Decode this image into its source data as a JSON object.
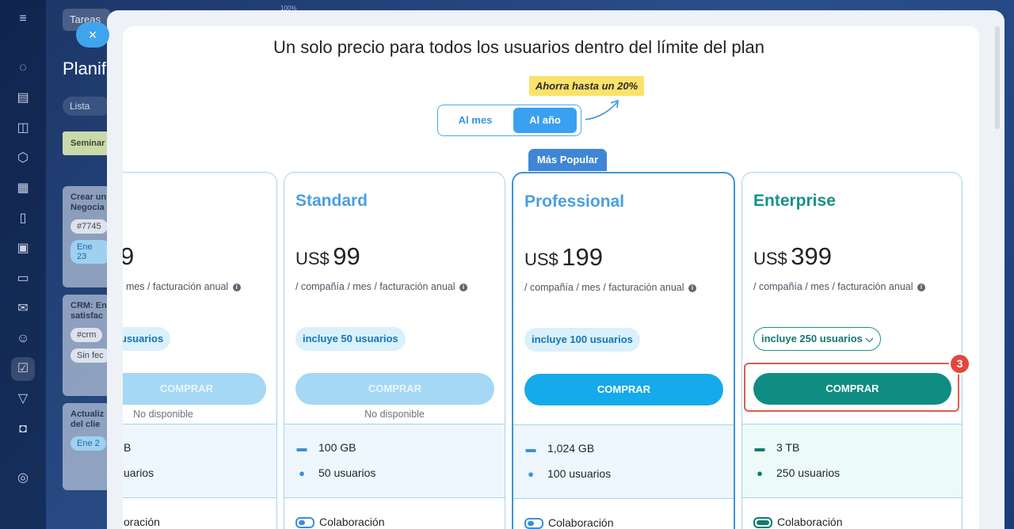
{
  "background": {
    "tab_label": "Tareas",
    "page_title": "Planif",
    "view_pill": "Lista",
    "column_header": "Seminar",
    "percent_label": "100%",
    "cards": [
      {
        "title": "Crear un",
        "title2": "Negocia",
        "tag": "#7745",
        "date": "Ene 23"
      },
      {
        "title": "CRM: En",
        "title2": "satisfac",
        "tag": "#crm",
        "date": "Sin fec"
      },
      {
        "title": "Actualiz",
        "title2": "del clie",
        "tag": "",
        "date": "Ene 2"
      }
    ],
    "close_label": "×"
  },
  "modal": {
    "title": "Un solo precio para todos los usuarios dentro del límite del plan",
    "savings_badge": "Ahorra hasta un 20%",
    "billing_toggle": {
      "monthly": "Al mes",
      "yearly": "Al año",
      "selected": "yearly"
    },
    "popular_label": "Más Popular",
    "plans": [
      {
        "id": "basic",
        "name": "",
        "currency": "",
        "price": "9",
        "billing": "/ mes / facturación anual",
        "users": "usuarios",
        "buy_label": "COMPRAR",
        "buy_enabled": false,
        "note": "No disponible",
        "storage": "B",
        "users_feature": "uarios",
        "collab": "oración"
      },
      {
        "id": "standard",
        "name": "Standard",
        "currency": "US$",
        "price": "99",
        "billing": "/ compañía / mes / facturación anual",
        "users": "incluye 50 usuarios",
        "buy_label": "COMPRAR",
        "buy_enabled": false,
        "note": "No disponible",
        "storage": "100 GB",
        "users_feature": "50 usuarios",
        "collab": "Colaboración"
      },
      {
        "id": "professional",
        "name": "Professional",
        "currency": "US$",
        "price": "199",
        "billing": "/ compañía / mes / facturación anual",
        "users": "incluye 100 usuarios",
        "buy_label": "COMPRAR",
        "buy_enabled": true,
        "note": "",
        "storage": "1,024 GB",
        "users_feature": "100 usuarios",
        "collab": "Colaboración"
      },
      {
        "id": "enterprise",
        "name": "Enterprise",
        "currency": "US$",
        "price": "399",
        "billing": "/ compañía / mes / facturación anual",
        "users": "incluye 250 usuarios",
        "buy_label": "COMPRAR",
        "buy_enabled": true,
        "note": "",
        "storage": "3 TB",
        "users_feature": "250 usuarios",
        "collab": "Colaboración"
      }
    ],
    "step_badge": "3",
    "info_glyph": "i",
    "chevron_glyph": "⌵"
  },
  "colors": {
    "accent": "#3aa1f0",
    "enterprise": "#0f8d83",
    "highlight": "#e25a4f",
    "badge": "#fbe26b"
  }
}
